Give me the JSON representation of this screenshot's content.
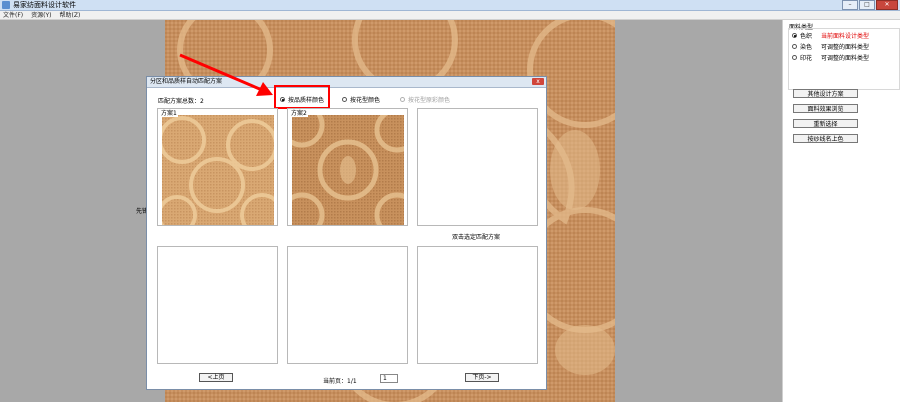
{
  "window": {
    "title": "易家纺面料设计软件"
  },
  "menu": [
    "文件(F)",
    "资源(Y)",
    "帮助(Z)"
  ],
  "side_label": "先锋",
  "right_panel": {
    "title": "面料类型",
    "options": [
      {
        "label": "色织",
        "desc": "当前面料设计类型",
        "selected": true
      },
      {
        "label": "染色",
        "desc": "可调整的面料类型",
        "selected": false
      },
      {
        "label": "印花",
        "desc": "可调整的面料类型",
        "selected": false
      }
    ],
    "buttons": [
      "其他设计方案",
      "面料效果浏览",
      "重新选择",
      "按纱线名上色"
    ]
  },
  "dialog": {
    "title": "分区和品质样自动匹配方案",
    "close": "x",
    "count_label": "匹配方案总数：2",
    "options": [
      {
        "label": "按品质样颜色",
        "selected": true,
        "enabled": true
      },
      {
        "label": "按花型颜色",
        "selected": false,
        "enabled": true
      },
      {
        "label": "按花型原彩颜色",
        "selected": false,
        "enabled": false
      }
    ],
    "slot_labels": [
      "方案1",
      "方案2"
    ],
    "hint": "双击选定匹配方案",
    "prev_button": "<上页",
    "next_button": "下页->",
    "page_label": "当前页：1/1",
    "page_input": "1"
  },
  "colors": {
    "fabric": "#c68e5e",
    "fabric_light": "#e2b684",
    "fabric_dark": "#a8703f",
    "highlight": "#ff0000",
    "accent_text": "#e00000"
  }
}
